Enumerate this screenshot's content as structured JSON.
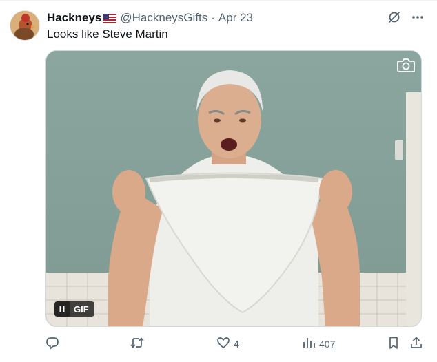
{
  "tweet": {
    "display_name": "Hackneys",
    "flag_icon": "us-flag-icon",
    "handle": "@HackneysGifts",
    "separator": "·",
    "date": "Apr 23",
    "text": "Looks like Steve Martin"
  },
  "media": {
    "badge_label": "GIF",
    "pause_icon": "pause-icon",
    "camera_icon": "camera-icon"
  },
  "actions": {
    "reply_icon": "reply-icon",
    "retweet_icon": "retweet-icon",
    "like_icon": "heart-icon",
    "like_count": "4",
    "views_icon": "bar-chart-icon",
    "views_count": "407",
    "bookmark_icon": "bookmark-icon",
    "share_icon": "share-icon"
  },
  "header_icons": {
    "grok_icon": "grok-slash-icon",
    "more_icon": "more-dots-icon"
  },
  "colors": {
    "text_primary": "#0f1419",
    "text_secondary": "#536471",
    "border": "#cfd9de"
  }
}
